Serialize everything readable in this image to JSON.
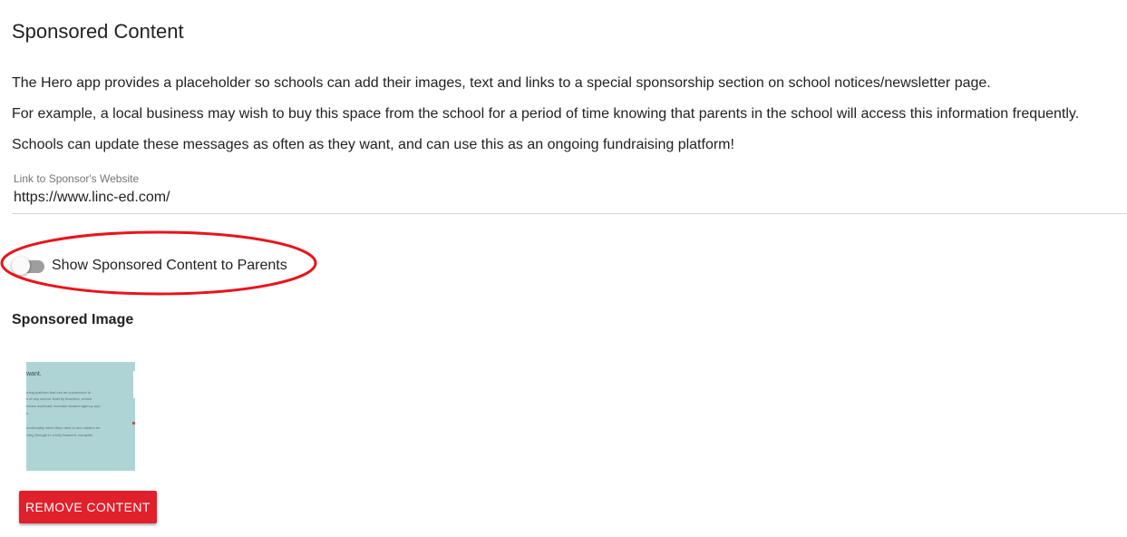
{
  "page": {
    "title": "Sponsored Content"
  },
  "intro": {
    "paragraphs": [
      "The Hero app provides a placeholder so schools can add their images, text and links to a special sponsorship section on school notices/newsletter page.",
      "For example, a local business may wish to buy this space from the school for a period of time knowing that parents in the school will access this information frequently.",
      "Schools can update these messages as often as they want, and can use this as an ongoing fundraising platform!"
    ]
  },
  "sponsor_link": {
    "label": "Link to Sponsor's Website",
    "value": "https://www.linc-ed.com/"
  },
  "visibility_toggle": {
    "label": "Show Sponsored Content to Parents",
    "checked": false
  },
  "sponsored_image": {
    "heading": "Sponsored Image",
    "preview_text": {
      "heading": "want.",
      "lines": [
        "rning platform that can be customised to",
        "s of any school. Built by teachers, school",
        "educe workload, increase student agency and",
        "s.",
        "unctionality when they need to and casters for",
        "ining through to a fully featured, complete"
      ]
    }
  },
  "actions": {
    "remove_label": "REMOVE CONTENT"
  },
  "colors": {
    "accent_danger": "#e0202a",
    "annotation_red": "#e8141c",
    "image_background": "#aed4d6",
    "switch_track": "#9e9e9e"
  }
}
